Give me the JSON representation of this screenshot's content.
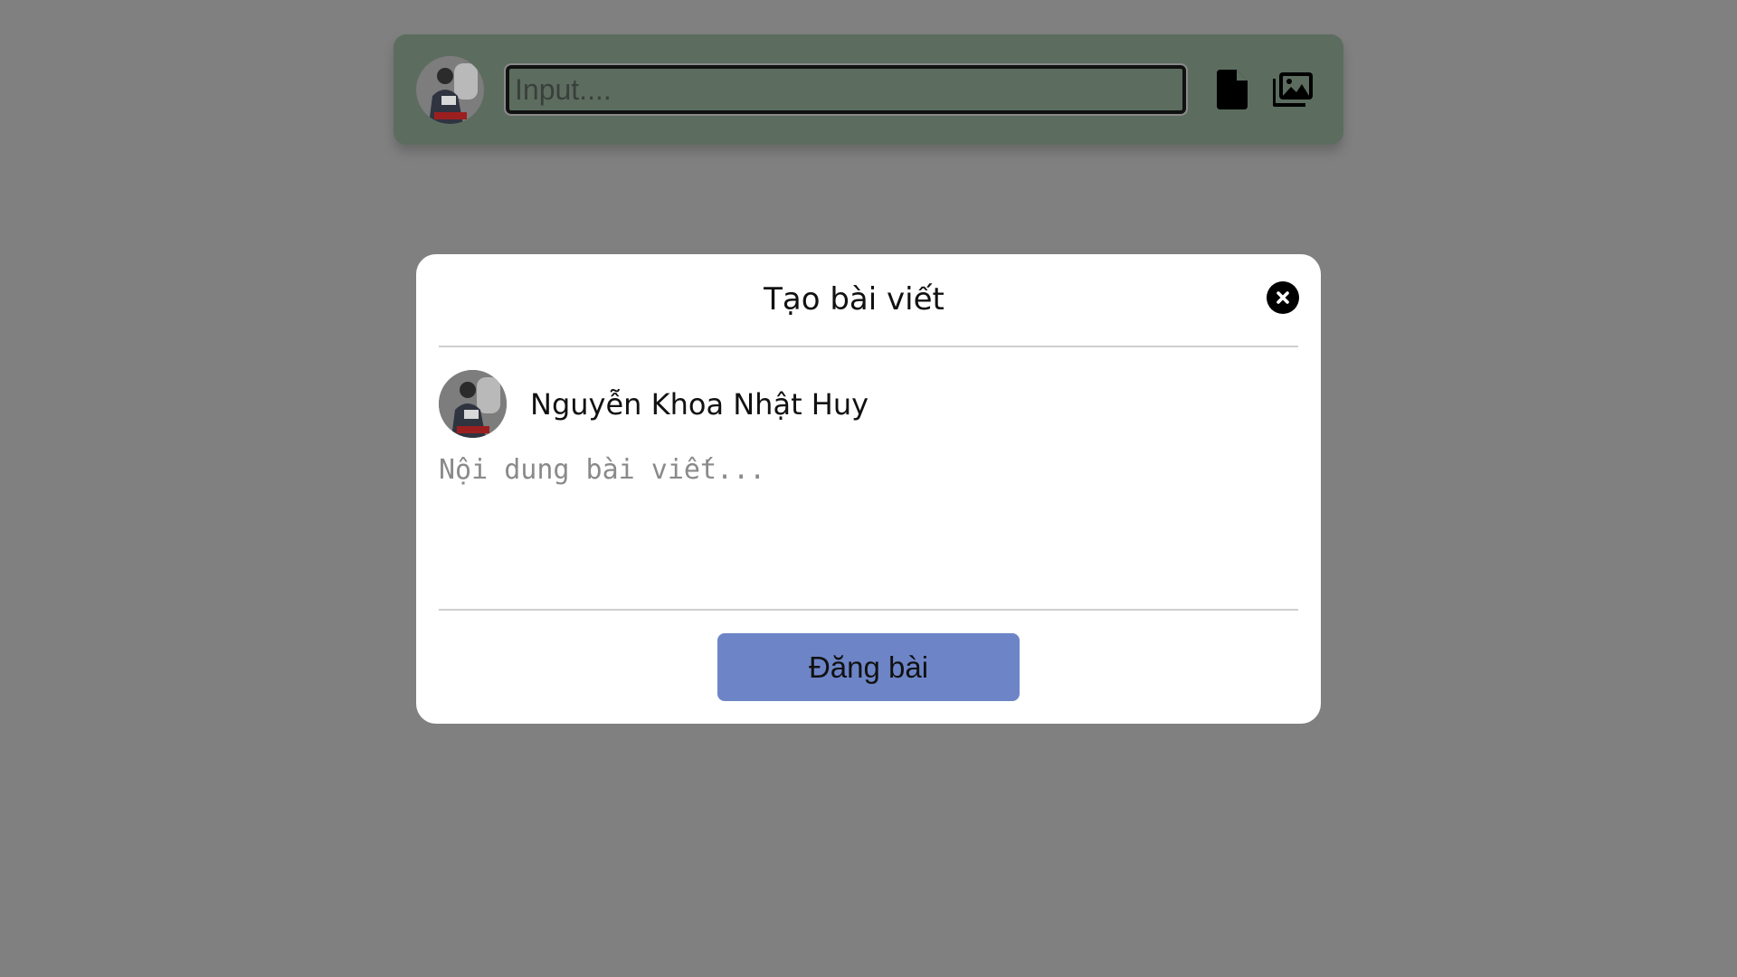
{
  "composer": {
    "input_placeholder": "Input....",
    "avatar_icon": "user-photo",
    "file_icon": "file-icon",
    "images_icon": "images-icon"
  },
  "modal": {
    "title": "Tạo bài viết",
    "close_icon": "close-icon",
    "author_name": "Nguyễn Khoa Nhật Huy",
    "content_placeholder": "Nội dung bài viết...",
    "submit_label": "Đăng bài"
  },
  "colors": {
    "overlay": "#808080",
    "composer_bg": "#5c6d5f",
    "submit_button": "#6d85c7",
    "modal_bg": "#ffffff"
  }
}
